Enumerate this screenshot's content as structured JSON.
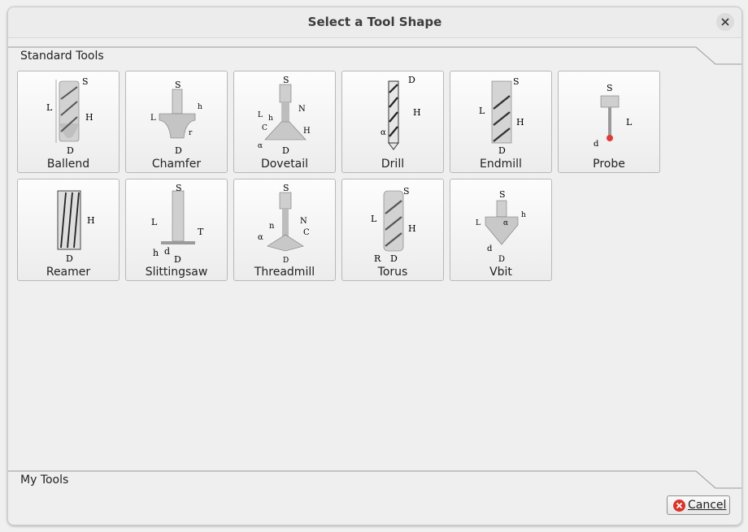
{
  "window": {
    "title": "Select a Tool Shape"
  },
  "sections": {
    "standard": "Standard Tools",
    "mine": "My Tools"
  },
  "tools": [
    {
      "name": "Ballend"
    },
    {
      "name": "Chamfer"
    },
    {
      "name": "Dovetail"
    },
    {
      "name": "Drill"
    },
    {
      "name": "Endmill"
    },
    {
      "name": "Probe"
    },
    {
      "name": "Reamer"
    },
    {
      "name": "Slittingsaw"
    },
    {
      "name": "Threadmill"
    },
    {
      "name": "Torus"
    },
    {
      "name": "Vbit"
    }
  ],
  "buttons": {
    "cancel": "Cancel"
  },
  "icons": {
    "close": "close-icon",
    "cancel": "cancel-icon"
  },
  "colors": {
    "window_bg": "#efefef",
    "cancel_icon": "#d9342b",
    "probe_tip": "#e03a3a"
  }
}
